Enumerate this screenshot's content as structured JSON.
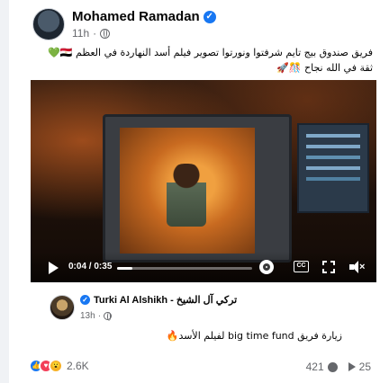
{
  "post": {
    "author": "Mohamed Ramadan",
    "time": "11h",
    "text_line1": "فريق صندوق بيج تايم شرفتوا ونورتوا تصوير فيلم أسد النهاردة في العظم 🇪🇬💚",
    "text_line2": "ثقة في الله نجاح 🎊🚀"
  },
  "video": {
    "current_time": "0:04",
    "duration": "0:35",
    "progress_fraction": 0.11,
    "icons": [
      "play-icon",
      "gear-icon",
      "cc-icon",
      "fullscreen-icon",
      "volume-muted-icon"
    ]
  },
  "shared": {
    "author": "Turki Al Alshikh - تركي آل الشيخ",
    "time": "13h",
    "text": "زيارة فريق big time fund لفيلم الأسد🔥"
  },
  "footer": {
    "reaction_count": "2.6K",
    "comments": "421",
    "shares": "25",
    "reactions": [
      "like",
      "love",
      "wow"
    ]
  },
  "colors": {
    "accent": "#1877f2",
    "text": "#050505",
    "secondary": "#65676b"
  }
}
